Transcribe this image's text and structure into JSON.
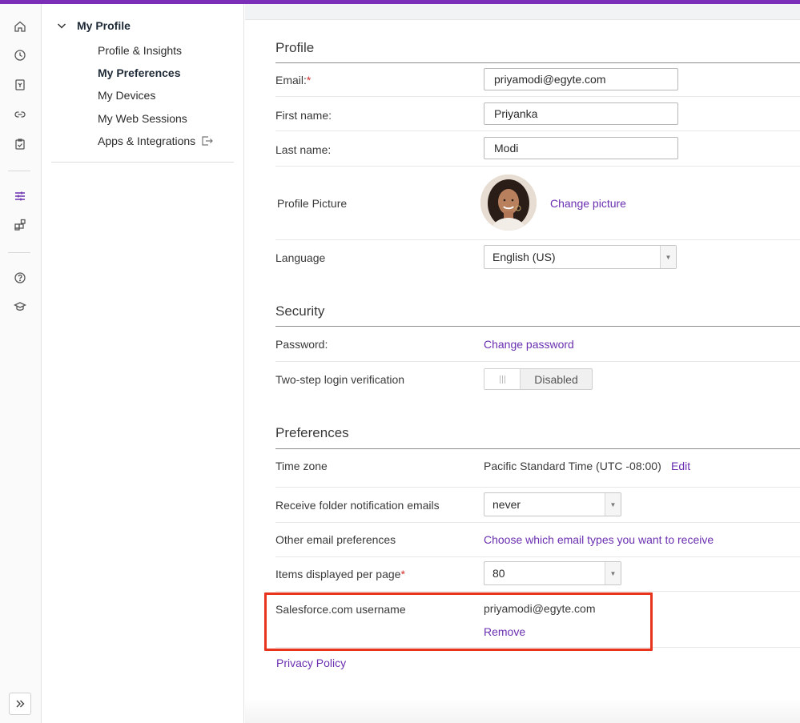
{
  "nav": {
    "title": "My Profile",
    "items": [
      {
        "label": "Profile & Insights"
      },
      {
        "label": "My Preferences"
      },
      {
        "label": "My Devices"
      },
      {
        "label": "My Web Sessions"
      },
      {
        "label": "Apps & Integrations"
      }
    ]
  },
  "profile": {
    "section_title": "Profile",
    "email_label": "Email:",
    "required_mark": "*",
    "email_value": "priyamodi@egyte.com",
    "first_name_label": "First name:",
    "first_name_value": "Priyanka",
    "last_name_label": "Last name:",
    "last_name_value": "Modi",
    "picture_label": "Profile Picture",
    "change_picture": "Change picture",
    "language_label": "Language",
    "language_value": "English (US)"
  },
  "security": {
    "section_title": "Security",
    "password_label": "Password:",
    "change_password": "Change password",
    "two_step_label": "Two-step login verification",
    "two_step_state": "Disabled"
  },
  "preferences": {
    "section_title": "Preferences",
    "timezone_label": "Time zone",
    "timezone_value": "Pacific Standard Time (UTC -08:00)",
    "timezone_edit": "Edit",
    "folder_notif_label": "Receive folder notification emails",
    "folder_notif_value": "never",
    "other_email_label": "Other email preferences",
    "other_email_link": "Choose which email types you want to receive",
    "items_per_page_label": "Items displayed per page",
    "items_per_page_value": "80",
    "salesforce_label": "Salesforce.com username",
    "salesforce_value": "priyamodi@egyte.com",
    "salesforce_remove": "Remove"
  },
  "footer": {
    "privacy_policy": "Privacy Policy"
  },
  "colors": {
    "accent": "#7b2fb8",
    "link": "#6a2fb0",
    "highlight": "#e8341c"
  }
}
